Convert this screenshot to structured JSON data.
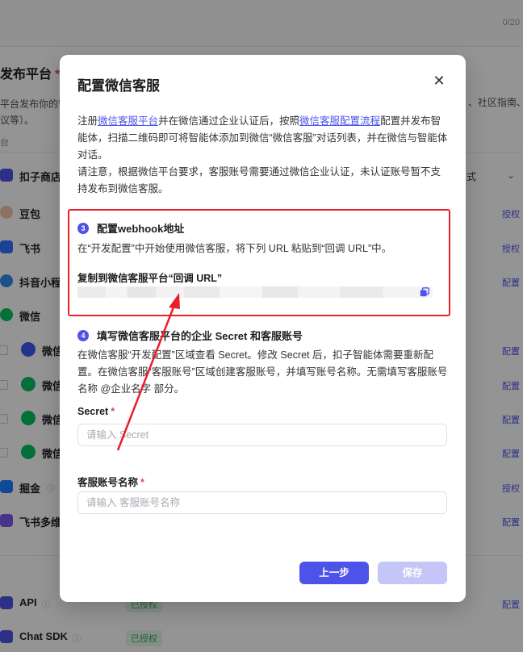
{
  "background": {
    "counter": "0/20",
    "section_title": "发布平台",
    "desc_line1": "平台发布你的智",
    "desc_line1_right": "、社区指南、",
    "desc_line2": "议等）。",
    "section_label": "台",
    "selector_text": "式",
    "platforms": [
      {
        "name": "扣子商店",
        "action": ""
      },
      {
        "name": "豆包",
        "action": "授权"
      },
      {
        "name": "飞书",
        "action": "授权"
      },
      {
        "name": "抖音小程",
        "action": "配置"
      },
      {
        "name": "微信",
        "action": ""
      },
      {
        "name": "微信",
        "action": "配置"
      },
      {
        "name": "微信",
        "action": "配置"
      },
      {
        "name": "微信",
        "action": "配置"
      },
      {
        "name": "微信",
        "action": "配置"
      },
      {
        "name": "掘金",
        "action": "授权"
      },
      {
        "name": "飞书多维",
        "action": "配置"
      }
    ],
    "api": {
      "name": "API",
      "tag": "已授权",
      "action": "配置"
    },
    "sdk": {
      "name": "Chat SDK",
      "tag": "已授权"
    }
  },
  "modal": {
    "title": "配置微信客服",
    "intro": {
      "p1_a": "注册",
      "p1_link1": "微信客服平台",
      "p1_b": "并在微信通过企业认证后，按照",
      "p1_link2": "微信客服配置流程",
      "p1_c": "配置并发布智能体，扫描二维码即可将智能体添加到微信“微信客服”对话列表，并在微信与智能体对话。",
      "p2": "请注意，根据微信平台要求，客服账号需要通过微信企业认证，未认证账号暂不支持发布到微信客服。"
    },
    "step3": {
      "num": "3",
      "title": "配置webhook地址",
      "text": "在“开发配置”中开始使用微信客服，将下列 URL 粘贴到“回调 URL”中。",
      "sub": "复制到微信客服平台“回调 URL”"
    },
    "step4": {
      "num": "4",
      "title": "填写微信客服平台的企业 Secret 和客服账号",
      "text": "在微信客服“开发配置”区域查看 Secret。修改 Secret 后，扣子智能体需要重新配置。在微信客服“客服账号”区域创建客服账号，并填写账号名称。无需填写客服账号名称 @企业名字 部分。"
    },
    "fields": {
      "secret_label": "Secret",
      "secret_placeholder": "请输入 Secret",
      "account_label": "客服账号名称",
      "account_placeholder": "请输入 客服账号名称",
      "required_mark": "*"
    },
    "buttons": {
      "prev": "上一步",
      "save": "保存"
    }
  },
  "colors": {
    "accent": "#4d53e8",
    "highlight": "#e8202a",
    "disabled": "#c3c6f6"
  }
}
